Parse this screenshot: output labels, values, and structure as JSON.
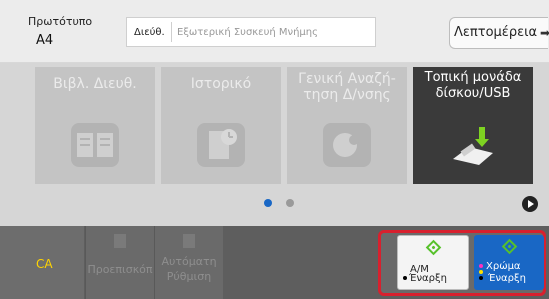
{
  "header": {
    "original_label": "Πρωτότυπο",
    "original_value": "A4",
    "address_label": "Διεύθ.",
    "address_placeholder": "Εξωτερική Συσκευή Μνήμης",
    "details_button": "Λεπτομέρεια",
    "details_arrow": "➡"
  },
  "tiles": [
    {
      "title": "Βιβλ. Διευθ.",
      "icon": "address-book-icon",
      "active": false
    },
    {
      "title": "Ιστορικό",
      "icon": "history-icon",
      "active": false
    },
    {
      "title": "Γενική Αναζή-τηση Δ/νσης",
      "title_line1": "Γενική Αναζή-",
      "title_line2": "τηση Δ/νσης",
      "icon": "global-search-icon",
      "active": false
    },
    {
      "title": "Τοπική μονάδα δίσκου/USB",
      "title_line1": "Τοπική μονάδα",
      "title_line2": "δίσκου/USB",
      "icon": "usb-drive-icon",
      "active": true
    }
  ],
  "pager": {
    "dots": 2,
    "current": 1
  },
  "bottom": {
    "ca_label": "CA",
    "preview_line1": "Προεπισκόπ",
    "auto_line1": "Αυτόματη",
    "auto_line2": "Ρύθμιση"
  },
  "start": {
    "bw_line1": "Α/Μ",
    "bw_line2": "Έναρξη",
    "color_line1": "Χρώμα",
    "color_line2": "Έναρξη"
  },
  "colors": {
    "accent_blue": "#1967c5",
    "highlight_red": "#d8202e",
    "ca_yellow": "#ffd400",
    "start_green": "#57c12b"
  }
}
